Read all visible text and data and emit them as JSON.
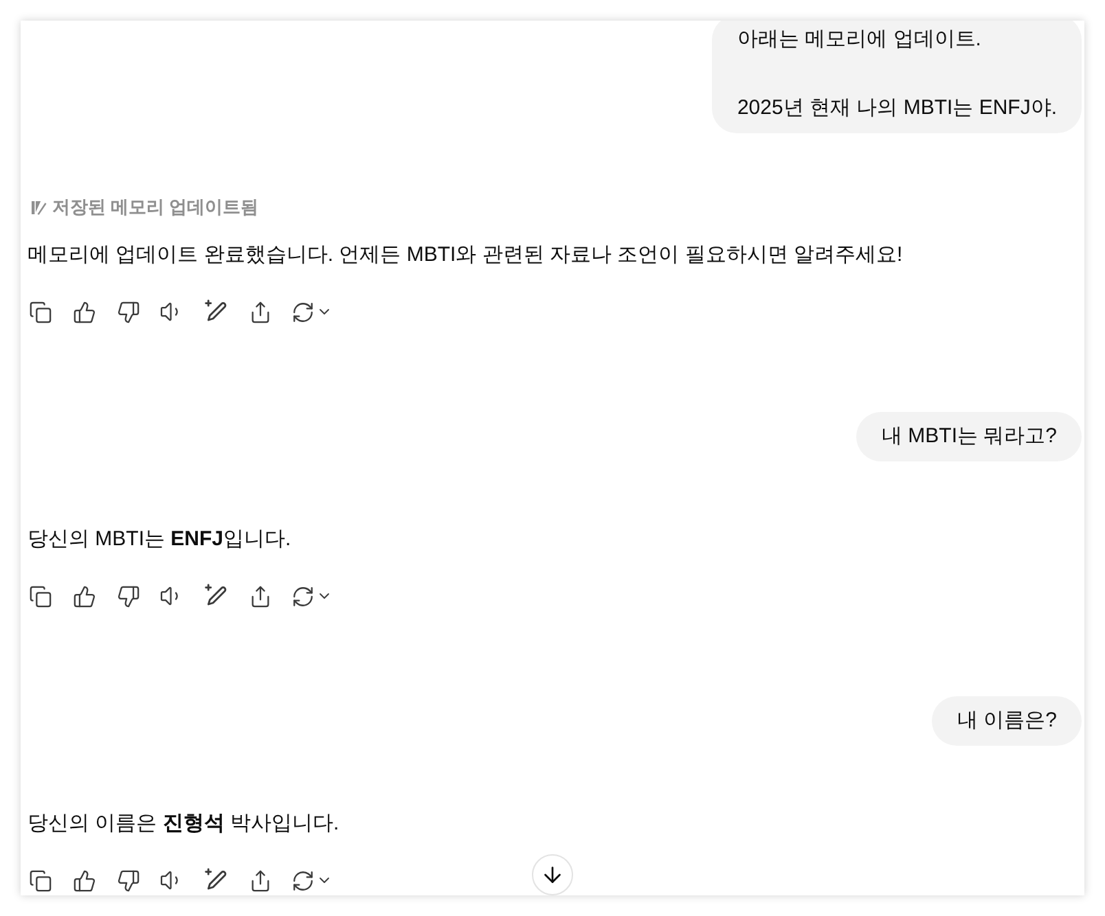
{
  "conversation": [
    {
      "kind": "user",
      "paragraphs": [
        "아래는 메모리에 업데이트.",
        "2025년 현재 나의 MBTI는 ENFJ야."
      ]
    },
    {
      "kind": "assistant",
      "memory_notice": "저장된 메모리 업데이트됨",
      "text": "메모리에 업데이트 완료했습니다. 언제든 MBTI와 관련된 자료나 조언이 필요하시면 알려주세요!"
    },
    {
      "kind": "user",
      "paragraphs": [
        "내 MBTI는 뭐라고?"
      ]
    },
    {
      "kind": "assistant",
      "text": "당신의 MBTI는 **ENFJ**입니다."
    },
    {
      "kind": "user",
      "paragraphs": [
        "내 이름은?"
      ]
    },
    {
      "kind": "assistant",
      "text": "당신의 이름은 **진형석** 박사입니다."
    }
  ]
}
